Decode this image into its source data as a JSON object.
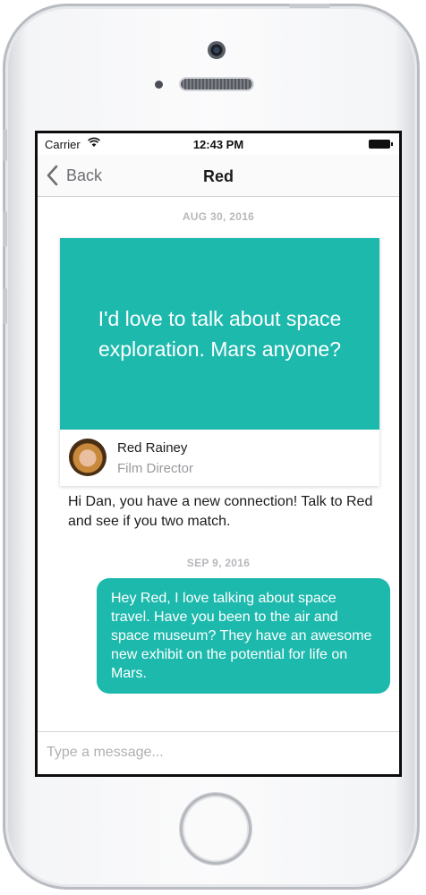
{
  "status_bar": {
    "carrier": "Carrier",
    "time": "12:43 PM",
    "icons": [
      "wifi-icon",
      "battery-icon"
    ]
  },
  "nav": {
    "back_label": "Back",
    "back_icon": "chevron-left-icon",
    "title": "Red"
  },
  "conversation": {
    "date_1": "AUG 30, 2016",
    "connection_card": {
      "prompt": "I'd love to talk about space exploration. Mars anyone?",
      "name": "Red Rainey",
      "title": "Film Director",
      "avatar_icon": "avatar-photo"
    },
    "system_message": "Hi Dan, you have a new connection! Talk to Red and see if you two match.",
    "date_2": "SEP 9, 2016",
    "sent_message": "Hey Red, I love talking about space travel. Have you been to the air and space museum? They have an awesome new exhibit on the potential for life on Mars."
  },
  "composer": {
    "placeholder": "Type a message...",
    "value": ""
  },
  "colors": {
    "accent": "#1db9ad",
    "date_label": "#b8b8bd",
    "subtitle": "#9a9a9e"
  }
}
